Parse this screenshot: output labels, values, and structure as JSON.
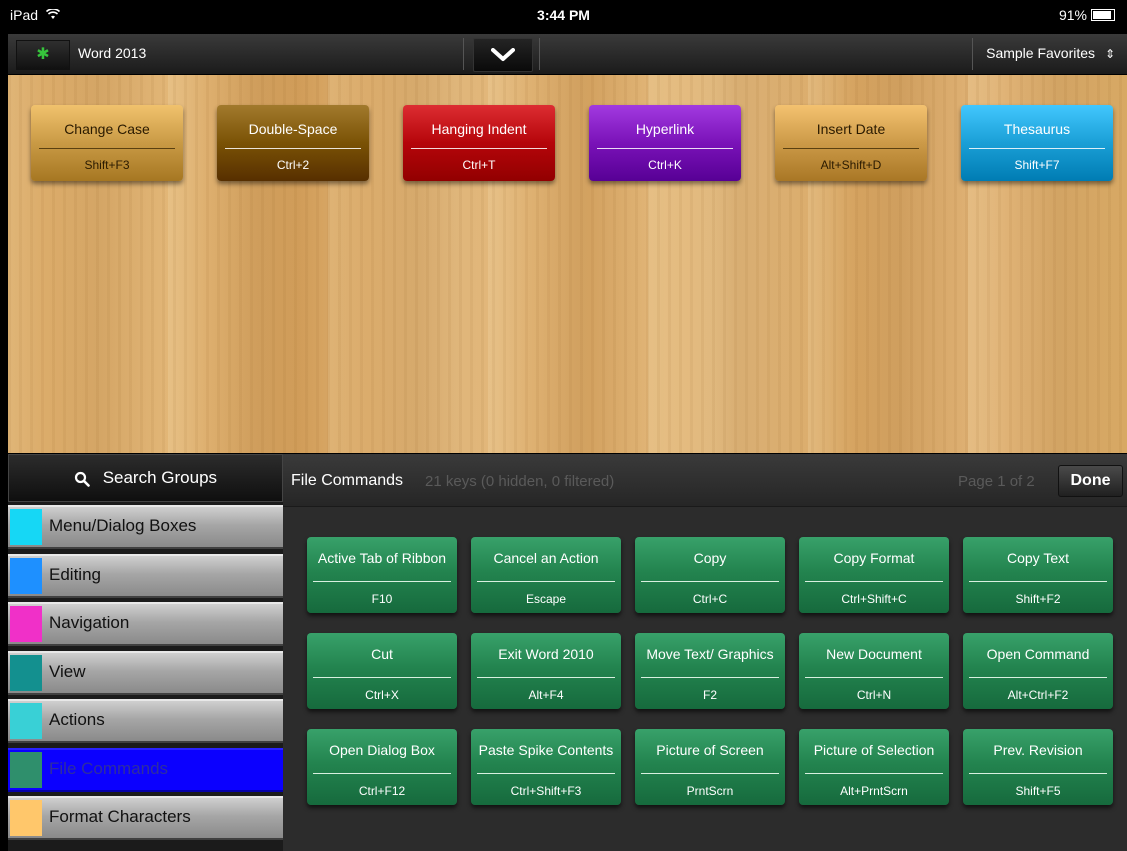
{
  "status_bar": {
    "device": "iPad",
    "time": "3:44 PM",
    "battery": "91%",
    "battery_level": 0.91
  },
  "top_bar": {
    "app_title": "Word 2013",
    "favorites_set": "Sample Favorites"
  },
  "favorites": [
    {
      "name": "Change Case",
      "keys": "Shift+F3",
      "color": "#c99a45"
    },
    {
      "name": "Double-Space",
      "keys": "Ctrl+2",
      "color": "#7a5205"
    },
    {
      "name": "Hanging Indent",
      "keys": "Ctrl+T",
      "color": "#b5050a"
    },
    {
      "name": "Hyperlink",
      "keys": "Ctrl+K",
      "color": "#7a12b8"
    },
    {
      "name": "Insert Date",
      "keys": "Alt+Shift+D",
      "color": "#cc9a48"
    },
    {
      "name": "Thesaurus",
      "keys": "Shift+F7",
      "color": "#1a9fd6"
    }
  ],
  "sidebar": {
    "search_label": "Search Groups",
    "groups": [
      {
        "label": "Menu/Dialog Boxes",
        "color": "#16d7f5"
      },
      {
        "label": "Editing",
        "color": "#1e90ff"
      },
      {
        "label": "Navigation",
        "color": "#f030c8"
      },
      {
        "label": "View",
        "color": "#13908f"
      },
      {
        "label": "Actions",
        "color": "#39d0d6"
      },
      {
        "label": "File Commands",
        "color": "#2f8f6c"
      },
      {
        "label": "Format Characters",
        "color": "#ffc76b"
      }
    ],
    "active_group": "File Commands"
  },
  "group_panel": {
    "title": "File Commands",
    "info": "21 keys (0 hidden, 0 filtered)",
    "page": "Page 1 of 2",
    "done_label": "Done",
    "keys": [
      {
        "name": "Active Tab of Ribbon",
        "keys": "F10"
      },
      {
        "name": "Cancel an Action",
        "keys": "Escape"
      },
      {
        "name": "Copy",
        "keys": "Ctrl+C"
      },
      {
        "name": "Copy Format",
        "keys": "Ctrl+Shift+C"
      },
      {
        "name": "Copy Text",
        "keys": "Shift+F2"
      },
      {
        "name": "Cut",
        "keys": "Ctrl+X"
      },
      {
        "name": "Exit Word 2010",
        "keys": "Alt+F4"
      },
      {
        "name": "Move Text/ Graphics",
        "keys": "F2"
      },
      {
        "name": "New Document",
        "keys": "Ctrl+N"
      },
      {
        "name": "Open Command",
        "keys": "Alt+Ctrl+F2"
      },
      {
        "name": "Open Dialog Box",
        "keys": "Ctrl+F12"
      },
      {
        "name": "Paste Spike Contents",
        "keys": "Ctrl+Shift+F3"
      },
      {
        "name": "Picture of Screen",
        "keys": "PrntScrn"
      },
      {
        "name": "Picture of Selection",
        "keys": "Alt+PrntScrn"
      },
      {
        "name": "Prev. Revision",
        "keys": "Shift+F5"
      }
    ]
  }
}
